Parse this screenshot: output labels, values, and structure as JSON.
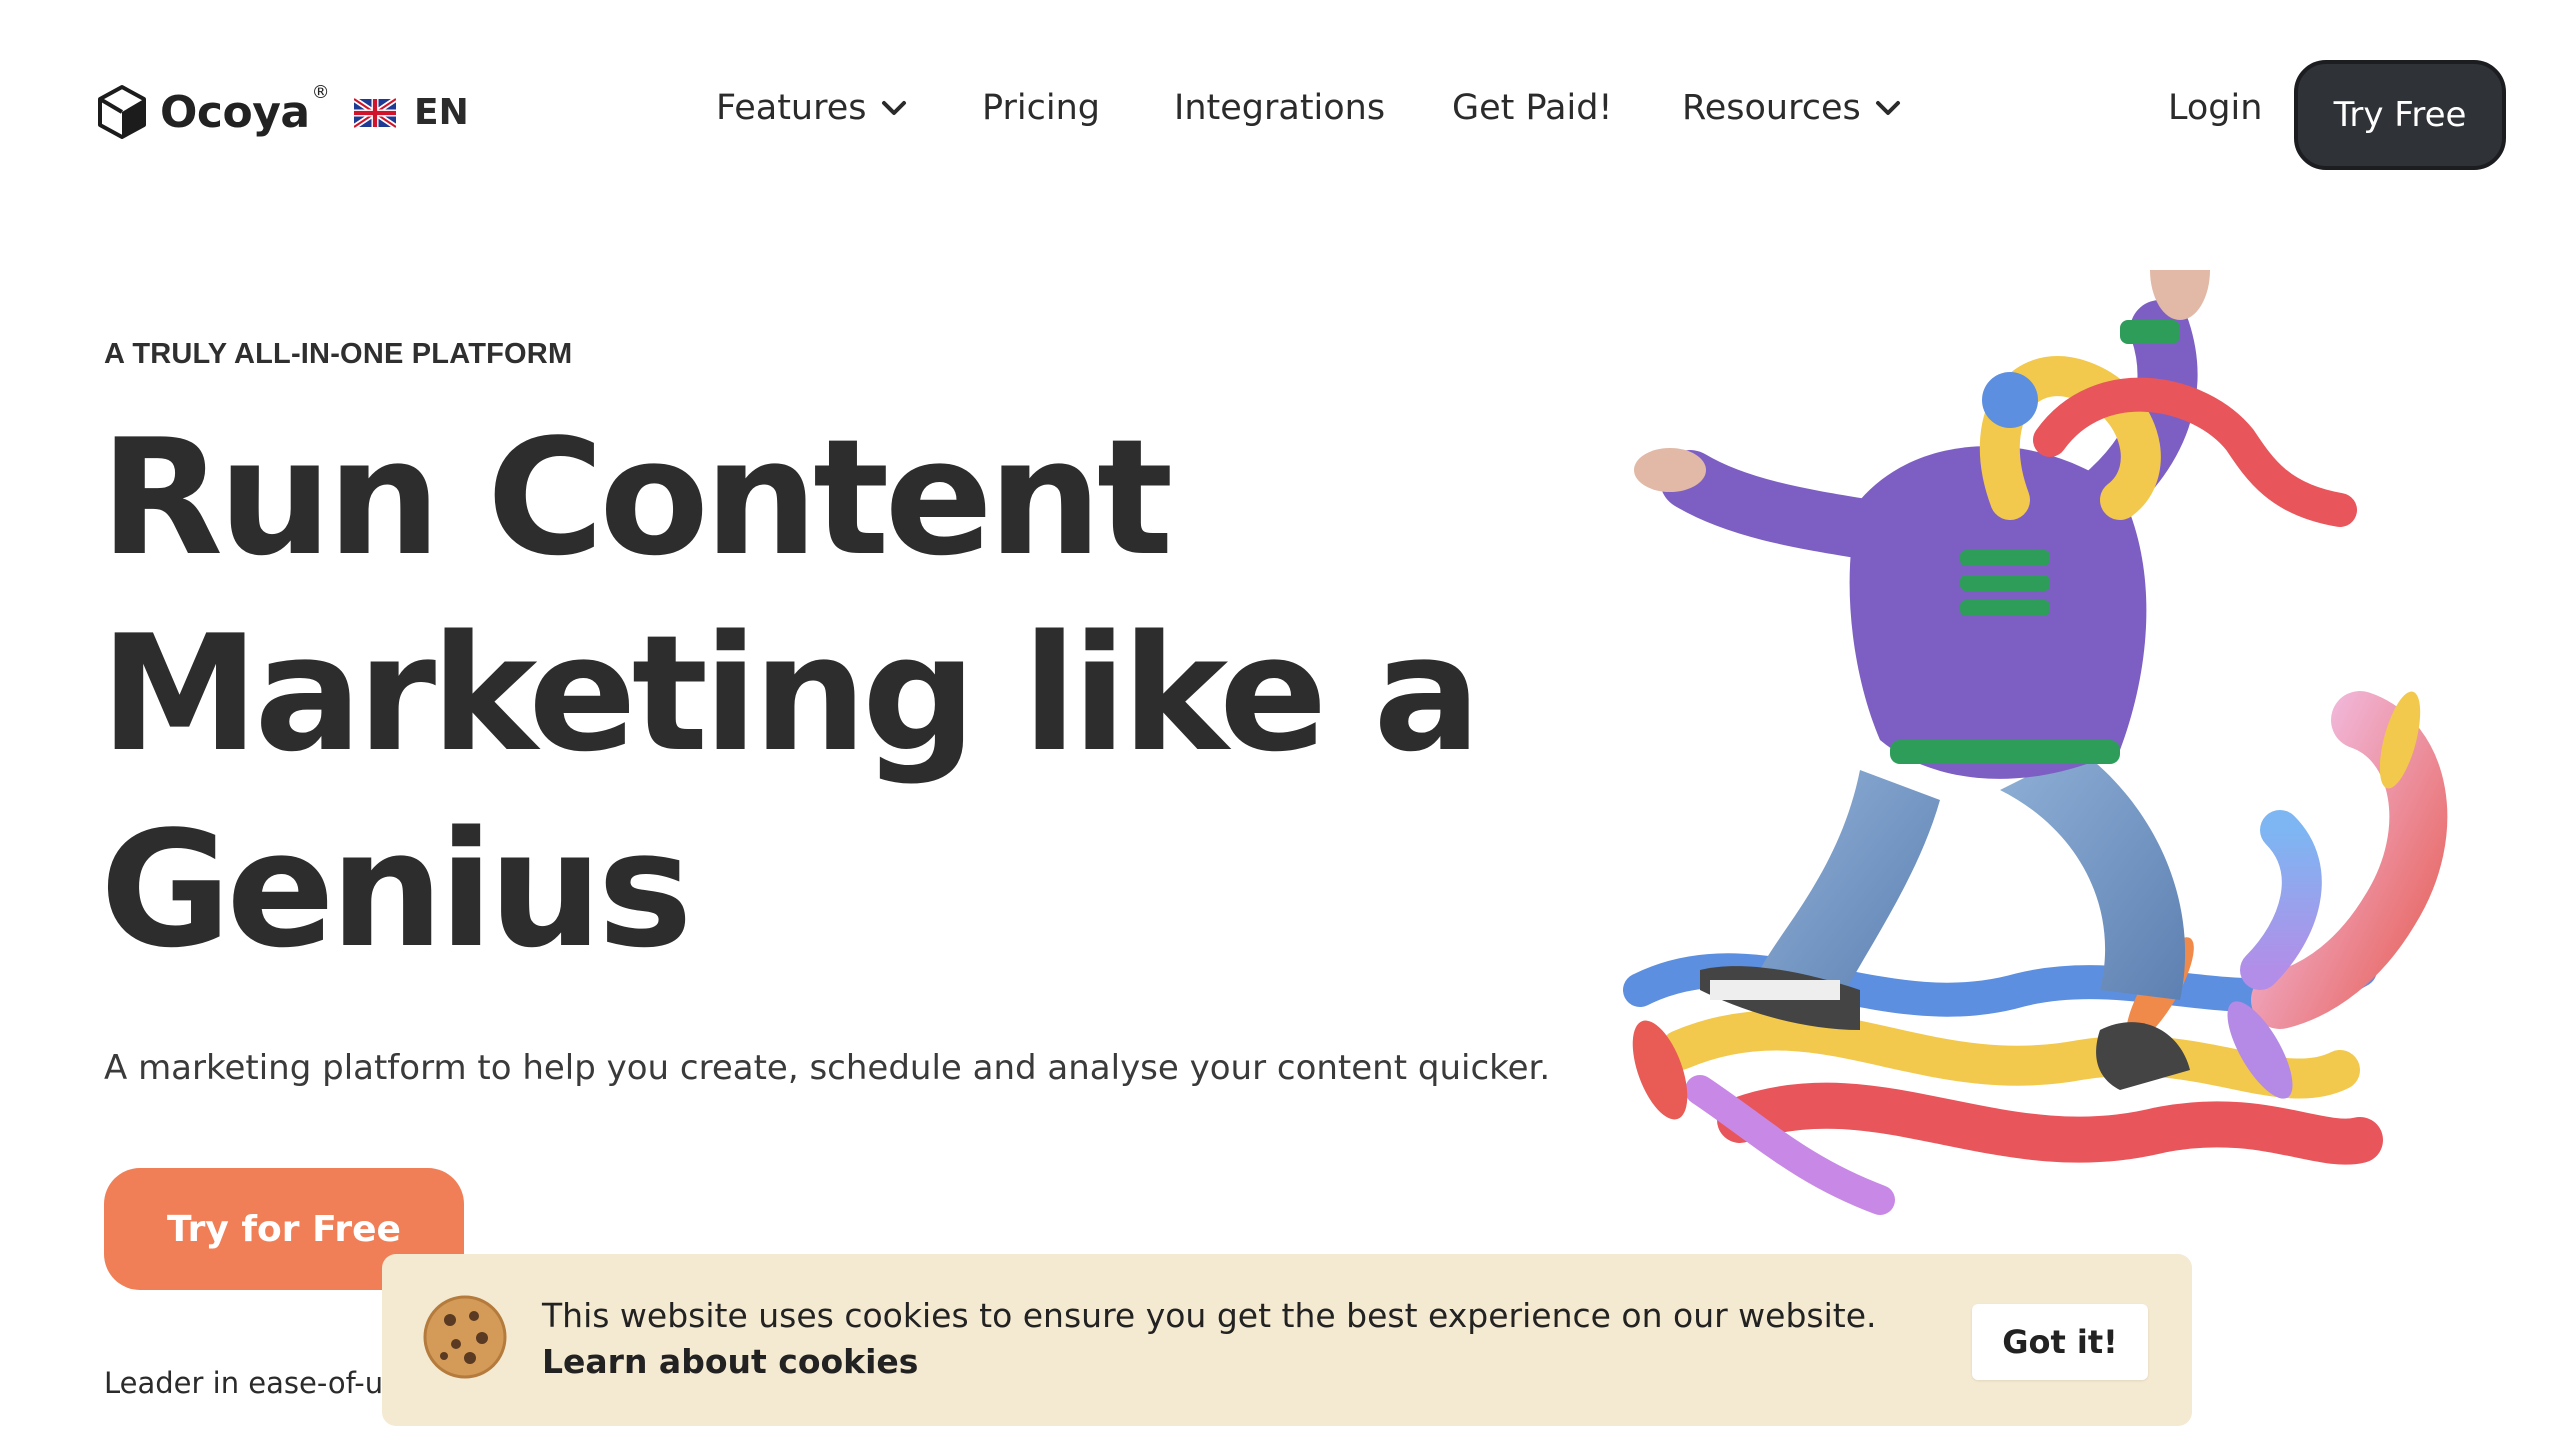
{
  "brand": {
    "name": "Ocoya",
    "reg_mark": "®"
  },
  "language": {
    "label": "EN",
    "flag": "uk-flag-icon"
  },
  "nav": {
    "items": [
      {
        "label": "Features",
        "has_dropdown": true
      },
      {
        "label": "Pricing",
        "has_dropdown": false
      },
      {
        "label": "Integrations",
        "has_dropdown": false
      },
      {
        "label": "Get Paid!",
        "has_dropdown": false
      },
      {
        "label": "Resources",
        "has_dropdown": true
      }
    ],
    "login_label": "Login",
    "try_free_label": "Try Free"
  },
  "hero": {
    "eyebrow": "A TRULY ALL-IN-ONE PLATFORM",
    "headline_line1": "Run Content",
    "headline_line2": "Marketing like a",
    "headline_line3": "Genius",
    "subtitle": "A marketing platform to help you create, schedule and analyse your content quicker.",
    "cta_label": "Try for Free",
    "leader_text": "Leader in ease-of-use"
  },
  "cookie_banner": {
    "message": "This website uses cookies to ensure you get the best experience on our website.",
    "link_label": "Learn about cookies",
    "button_label": "Got it!"
  },
  "colors": {
    "accent": "#f07f57",
    "dark_button": "#2f3237",
    "cookie_bg": "#f4e9d1",
    "text": "#2b2b2b"
  }
}
